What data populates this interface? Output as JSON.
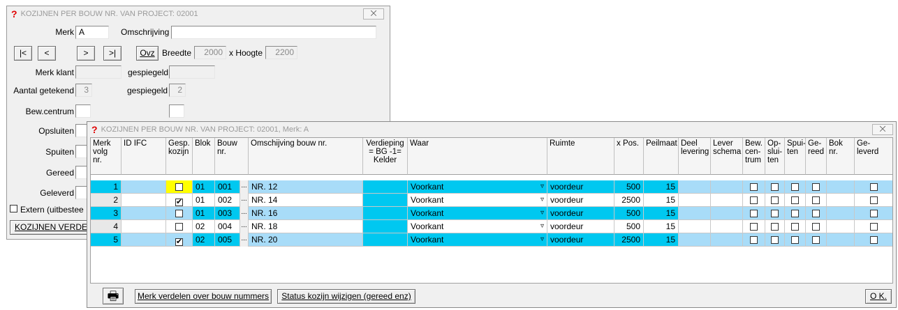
{
  "back_window": {
    "title": "KOZIJNEN PER BOUW NR. VAN PROJECT: 02001",
    "close_glyph": "⨉",
    "merk_label": "Merk",
    "merk_value": "A",
    "omschrijving_label": "Omschrijving",
    "omschrijving_value": "",
    "nav_first": "|<",
    "nav_prev": "<",
    "nav_next": ">",
    "nav_last": ">|",
    "ovz_label": "Ovz",
    "breedte_label": "Breedte",
    "breedte_value": "2000",
    "hoogte_label": "x Hoogte",
    "hoogte_value": "2200",
    "merk_klant_label": "Merk klant",
    "merk_klant_value": "",
    "gespiegeld_label": "gespiegeld",
    "gespiegeld_value": "",
    "aantal_label": "Aantal getekend",
    "aantal_value": "3",
    "gespiegeld2_label": "gespiegeld",
    "gespiegeld2_value": "2",
    "bewcentrum_label": "Bew.centrum",
    "opsluiten_label": "Opsluiten",
    "spuiten_label": "Spuiten",
    "gereed_label": "Gereed",
    "geleverd_label": "Geleverd",
    "extern_label": "Extern (uitbestee",
    "kozijnen_btn": "KOZIJNEN VERDE"
  },
  "front_window": {
    "title": "KOZIJNEN PER BOUW NR. VAN PROJECT: 02001, Merk: A",
    "close_glyph": "⨉",
    "headers": {
      "merk_volg": "Merk volg nr.",
      "id_ifc": "ID IFC",
      "gesp_kozijn": "Gesp. kozijn",
      "blok": "Blok",
      "bouw_nr": "Bouw nr.",
      "omschrijving": "Omschijving bouw nr.",
      "verdieping": "Verdieping = BG -1= Kelder",
      "waar": "Waar",
      "ruimte": "Ruimte",
      "xpos": "x Pos.",
      "peilmaat": "Peilmaat",
      "deel_levering": "Deel levering",
      "lever_schema": "Lever schema",
      "bew_centrum": "Bew. cen- trum",
      "opsluiten": "Op- slui- ten",
      "spuiten": "Spui- ten",
      "gereed": "Ge- reed",
      "bok_nr": "Bok nr.",
      "geleverd": "Ge- leverd"
    },
    "rows": [
      {
        "volg": "1",
        "gesp": "",
        "blok": "01",
        "bouw": "001",
        "omschr": "NR. 12",
        "waar": "Voorkant",
        "ruimte": "voordeur",
        "xpos": "500",
        "peil": "15"
      },
      {
        "volg": "2",
        "gesp": "✔",
        "blok": "01",
        "bouw": "002",
        "omschr": "NR. 14",
        "waar": "Voorkant",
        "ruimte": "voordeur",
        "xpos": "2500",
        "peil": "15"
      },
      {
        "volg": "3",
        "gesp": "",
        "blok": "01",
        "bouw": "003",
        "omschr": "NR. 16",
        "waar": "Voorkant",
        "ruimte": "voordeur",
        "xpos": "500",
        "peil": "15"
      },
      {
        "volg": "4",
        "gesp": "",
        "blok": "02",
        "bouw": "004",
        "omschr": "NR. 18",
        "waar": "Voorkant",
        "ruimte": "voordeur",
        "xpos": "500",
        "peil": "15"
      },
      {
        "volg": "5",
        "gesp": "✔",
        "blok": "02",
        "bouw": "005",
        "omschr": "NR. 20",
        "waar": "Voorkant",
        "ruimte": "voordeur",
        "xpos": "2500",
        "peil": "15"
      }
    ],
    "ellipsis": "...",
    "dropdown_glyph": "▿",
    "printer_icon": "🖶",
    "btn_merk_verdelen": "Merk verdelen over bouw nummers",
    "btn_status": "Status kozijn wijzigen (gereed enz)",
    "btn_ok": "O K."
  },
  "colors": {
    "highlight_row": "#a8dcf8",
    "cyan_cell": "#00c8f0",
    "yellow_cell": "#ffff00",
    "white": "#ffffff",
    "window_bg": "#f0f0f0"
  }
}
